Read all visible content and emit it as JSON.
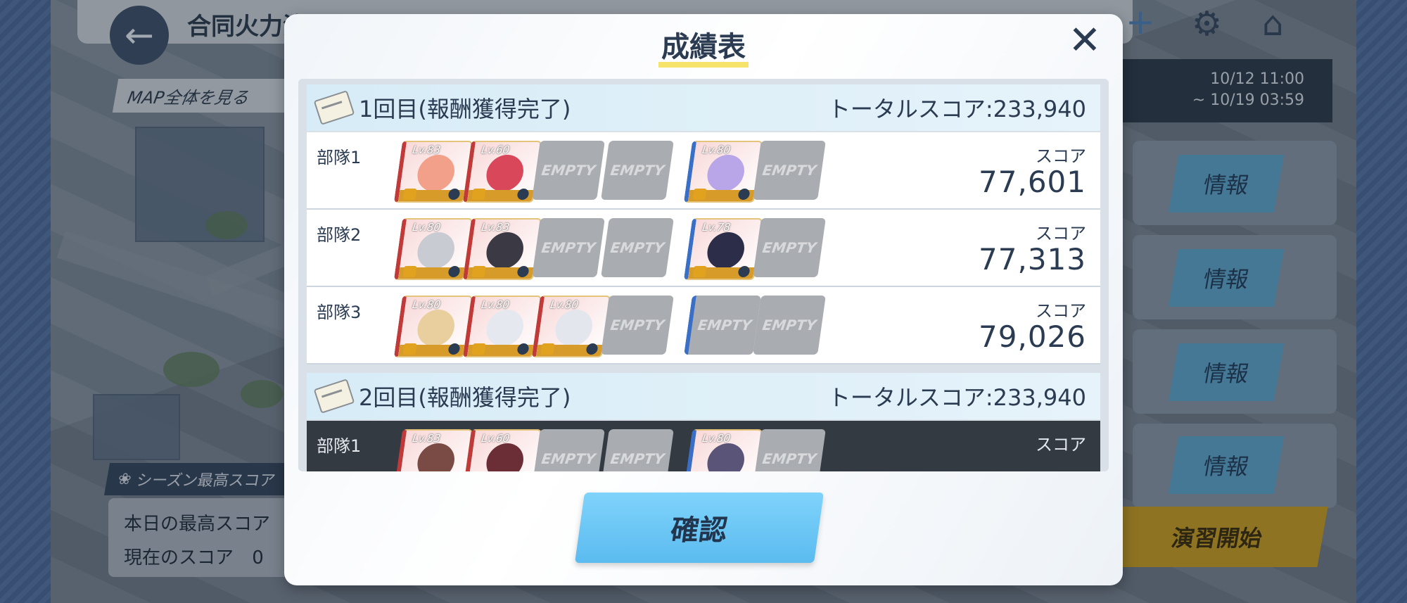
{
  "background": {
    "stage_title": "合同火力演習 ?",
    "map_button_label": "MAP全体を見る",
    "period_start": "10/12 11:00",
    "period_end": "~ 10/19 03:59",
    "info_label": "情報",
    "season_label": "シーズン最高スコア",
    "today_best_label": "本日の最高スコア",
    "current_score_label": "現在のスコア",
    "current_score_value": "0",
    "start_label": "演習開始"
  },
  "modal": {
    "title": "成績表",
    "confirm_label": "確認",
    "empty_label": "EMPTY",
    "score_label": "スコア"
  },
  "rounds": [
    {
      "title": "1回目(報酬獲得完了)",
      "total": "トータルスコア:233,940",
      "teams": [
        {
          "name": "部隊1",
          "score": "77,601",
          "slots": [
            {
              "lv": "Lv.83",
              "color": "#f2a08a"
            },
            {
              "lv": "Lv.60",
              "color": "#d9475a"
            },
            {
              "empty": true
            },
            {
              "empty": true
            },
            {
              "lv": "Lv.80",
              "color": "#b9a6e8"
            },
            {
              "empty": true
            }
          ]
        },
        {
          "name": "部隊2",
          "score": "77,313",
          "slots": [
            {
              "lv": "Lv.80",
              "color": "#c8cbd2"
            },
            {
              "lv": "Lv.83",
              "color": "#3b3a44"
            },
            {
              "empty": true
            },
            {
              "empty": true
            },
            {
              "lv": "Lv.78",
              "color": "#2c2d48"
            },
            {
              "empty": true
            }
          ]
        },
        {
          "name": "部隊3",
          "score": "79,026",
          "slots": [
            {
              "lv": "Lv.80",
              "color": "#e9cf9d"
            },
            {
              "lv": "Lv.80",
              "color": "#e6e8f0"
            },
            {
              "lv": "Lv.80",
              "color": "#e4e6ee"
            },
            {
              "empty": true
            },
            {
              "empty": true
            },
            {
              "empty": true
            }
          ]
        }
      ]
    },
    {
      "title": "2回目(報酬獲得完了)",
      "total": "トータルスコア:233,940",
      "teams": [
        {
          "name": "部隊1",
          "score": "",
          "slots": [
            {
              "lv": "Lv.83",
              "color": "#7a4a44"
            },
            {
              "lv": "Lv.60",
              "color": "#6c2e36"
            },
            {
              "empty": true
            },
            {
              "empty": true
            },
            {
              "lv": "Lv.80",
              "color": "#5a5478"
            },
            {
              "empty": true
            }
          ]
        }
      ]
    }
  ]
}
